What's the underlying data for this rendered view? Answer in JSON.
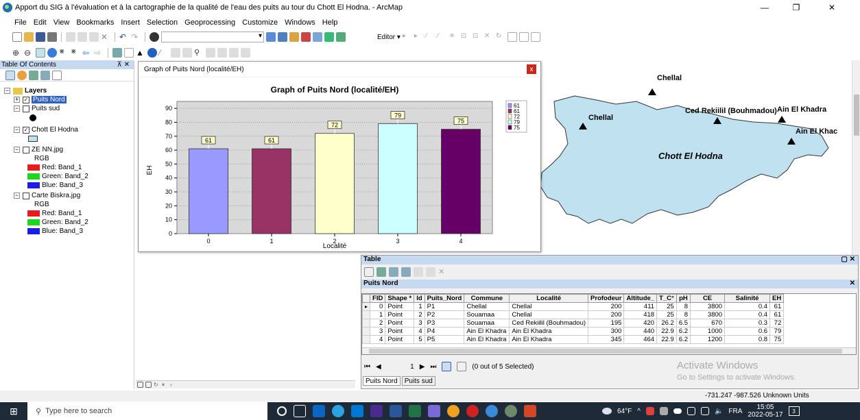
{
  "window": {
    "title": "Apport du SIG à l'évaluation et à la cartographie de la qualité de l'eau des puits au tour du Chott El Hodna. - ArcMap",
    "minimize": "—",
    "maximize": "❐",
    "close": "✕"
  },
  "menu": [
    "File",
    "Edit",
    "View",
    "Bookmarks",
    "Insert",
    "Selection",
    "Geoprocessing",
    "Customize",
    "Windows",
    "Help"
  ],
  "toolbar": {
    "editor_label": "Editor ▾"
  },
  "toc": {
    "title": "Table Of Contents",
    "pin": "⊼ ✕",
    "layers_label": "Layers",
    "items": [
      {
        "label": "Puits Nord",
        "checked": true,
        "selected": true
      },
      {
        "label": "Puits sud",
        "checked": false
      },
      {
        "label": "Chott El Hodna",
        "checked": true
      },
      {
        "label": "ZE NN.jpg",
        "checked": false,
        "rgb": "RGB",
        "bands": [
          "Red:   Band_1",
          "Green: Band_2",
          "Blue:  Band_3"
        ]
      },
      {
        "label": "Carte Biskra.jpg",
        "checked": false,
        "rgb": "RGB",
        "bands": [
          "Red:   Band_1",
          "Green: Band_2",
          "Blue:  Band_3"
        ]
      }
    ],
    "band_colors": [
      "#e81c1c",
      "#1cd81c",
      "#1c1ce8"
    ]
  },
  "map": {
    "lake_label": "Chott El Hodna",
    "lake_color": "#bfe1f0",
    "points": [
      "Chellal",
      "Chellal",
      "Ced Rekiilil (Bouhmadou)",
      "Ain El Khadra",
      "Ain El Khac"
    ]
  },
  "graph": {
    "window_title": "Graph of Puits Nord (localité/EH)",
    "close": "x"
  },
  "chart_data": {
    "type": "bar",
    "title": "Graph of Puits Nord (localité/EH)",
    "xlabel": "Localité",
    "ylabel": "EH",
    "categories": [
      "0",
      "1",
      "2",
      "3",
      "4"
    ],
    "values": [
      61,
      61,
      72,
      79,
      75
    ],
    "colors": [
      "#9999ff",
      "#993366",
      "#ffffcc",
      "#ccffff",
      "#660066"
    ],
    "ylim": [
      0,
      95
    ],
    "yticks": [
      0,
      10,
      20,
      30,
      40,
      50,
      60,
      70,
      80,
      90
    ],
    "legend": [
      "61",
      "61",
      "72",
      "79",
      "75"
    ],
    "legend_position": "top-right",
    "grid": true
  },
  "table": {
    "title": "Table",
    "layer_title": "Puits Nord",
    "columns": [
      "FID",
      "Shape *",
      "Id",
      "Puits_Nord",
      "Commune",
      "Localité",
      "Profodeur",
      "Altitude_",
      "T_C°",
      "pH",
      "CE",
      "Salinité",
      "EH"
    ],
    "rows": [
      [
        "0",
        "Point",
        "1",
        "P1",
        "Chellal",
        "Chellal",
        "200",
        "411",
        "25",
        "8",
        "3800",
        "0.4",
        "61"
      ],
      [
        "1",
        "Point",
        "2",
        "P2",
        "Souamaa",
        "Chellal",
        "200",
        "418",
        "25",
        "8",
        "3800",
        "0.4",
        "61"
      ],
      [
        "2",
        "Point",
        "3",
        "P3",
        "Souamaa",
        "Ced Rekiilil (Bouhmadou)",
        "195",
        "420",
        "26.2",
        "6.5",
        "670",
        "0.3",
        "72"
      ],
      [
        "3",
        "Point",
        "4",
        "P4",
        "Ain El Khadra",
        "Ain El Khadra",
        "300",
        "440",
        "22.9",
        "6.2",
        "1000",
        "0.6",
        "79"
      ],
      [
        "4",
        "Point",
        "5",
        "P5",
        "Ain El Khadra",
        "Ain El Khadra",
        "345",
        "464",
        "22.9",
        "6.2",
        "1200",
        "0.8",
        "75"
      ]
    ],
    "nav_record": "1",
    "selection_text": "(0 out of 5 Selected)",
    "tabs": [
      "Puits Nord",
      "Puits sud"
    ]
  },
  "watermark": {
    "line1": "Activate Windows",
    "line2": "Go to Settings to activate Windows."
  },
  "status": {
    "coords": "-731.247  -987.526 Unknown Units"
  },
  "taskbar": {
    "search_placeholder": "Type here to search",
    "weather": "64°F",
    "lang": "FRA",
    "time": "15:05",
    "date": "2022-05-17",
    "notif": "3"
  }
}
